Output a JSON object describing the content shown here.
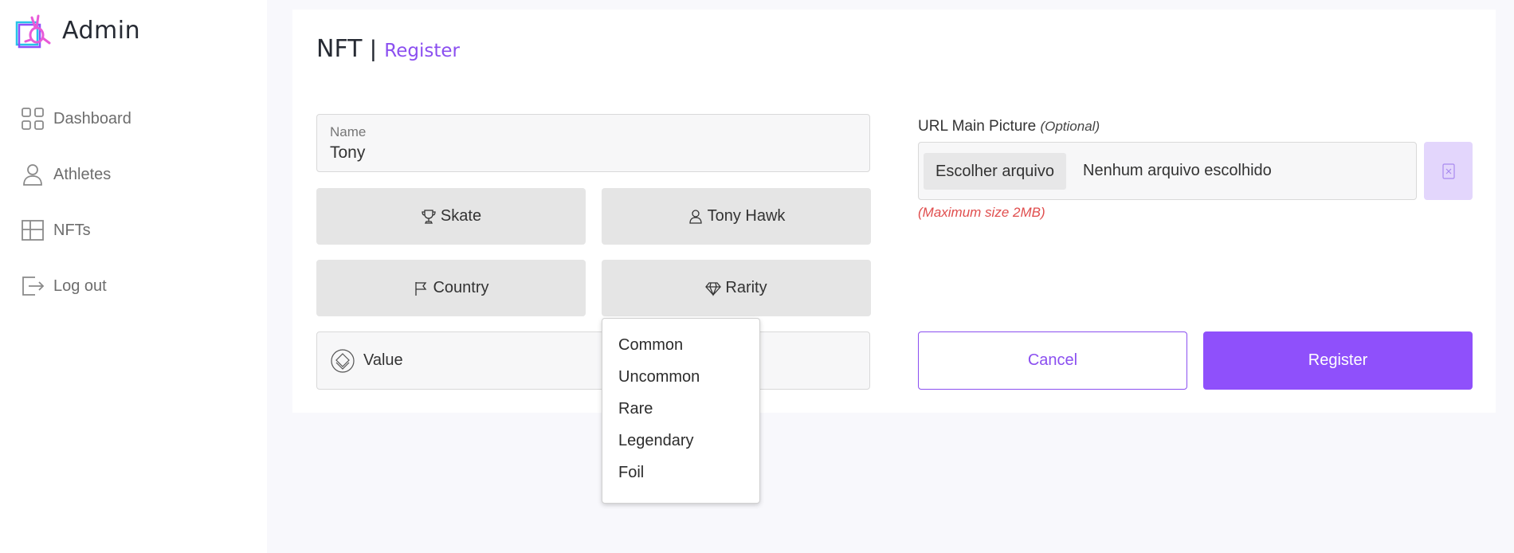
{
  "brand": {
    "name": "Admin",
    "logo_icon": "bunny-logo-icon"
  },
  "sidebar": {
    "items": [
      {
        "label": "Dashboard",
        "icon": "grid-icon"
      },
      {
        "label": "Athletes",
        "icon": "user-icon"
      },
      {
        "label": "NFTs",
        "icon": "layout-icon"
      },
      {
        "label": "Log out",
        "icon": "logout-icon"
      }
    ]
  },
  "header": {
    "title": "NFT",
    "separator": "|",
    "subtitle": "Register"
  },
  "form": {
    "name": {
      "label": "Name",
      "value": "Tony"
    },
    "skate_button": "Skate",
    "athlete_button": "Tony Hawk",
    "country_button": "Country",
    "rarity_button": "Rarity",
    "value_label": "Value",
    "rarity_options": [
      "Common",
      "Uncommon",
      "Rare",
      "Legendary",
      "Foil"
    ],
    "url_picture": {
      "label": "URL Main Picture",
      "optional": "(Optional)",
      "file_button": "Escolher arquivo",
      "file_status": "Nenhum arquivo escolhido",
      "max_size": "(Maximum size 2MB)"
    },
    "cancel_label": "Cancel",
    "register_label": "Register"
  },
  "colors": {
    "accent": "#8f50fb",
    "accent_light": "#e3d6fc",
    "error": "#e04e4e",
    "background": "#f8f8fc"
  }
}
